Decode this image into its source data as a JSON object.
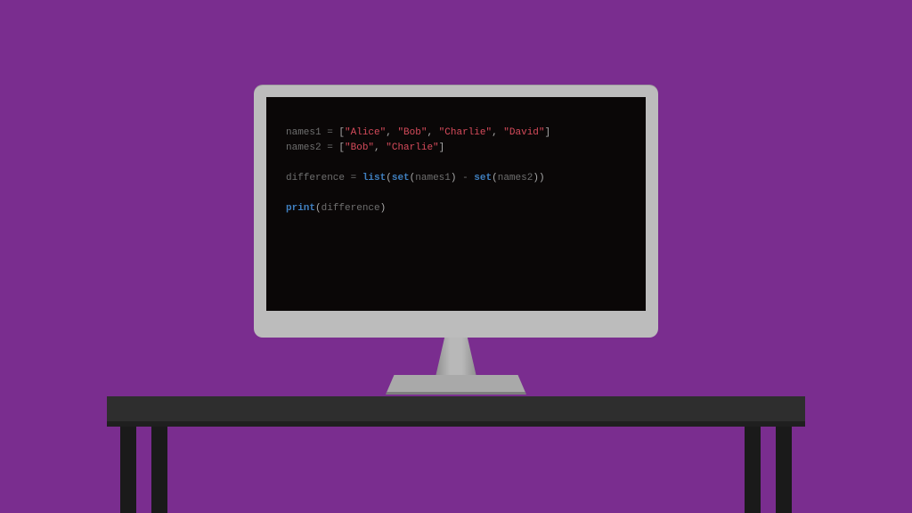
{
  "code": {
    "line1": {
      "var": "names1",
      "eq": " = ",
      "lb": "[",
      "s1": "\"Alice\"",
      "c1": ", ",
      "s2": "\"Bob\"",
      "c2": ", ",
      "s3": "\"Charlie\"",
      "c3": ", ",
      "s4": "\"David\"",
      "rb": "]"
    },
    "line2": {
      "var": "names2",
      "eq": " = ",
      "lb": "[",
      "s1": "\"Bob\"",
      "c1": ", ",
      "s2": "\"Charlie\"",
      "rb": "]"
    },
    "line3": {
      "var": "difference",
      "eq": " = ",
      "fn1": "list",
      "p1": "(",
      "fn2": "set",
      "p2": "(",
      "arg1": "names1",
      "p3": ")",
      "minus": " - ",
      "fn3": "set",
      "p4": "(",
      "arg2": "names2",
      "p5": ")",
      "p6": ")"
    },
    "line4": {
      "fn": "print",
      "p1": "(",
      "arg": "difference",
      "p2": ")"
    }
  }
}
